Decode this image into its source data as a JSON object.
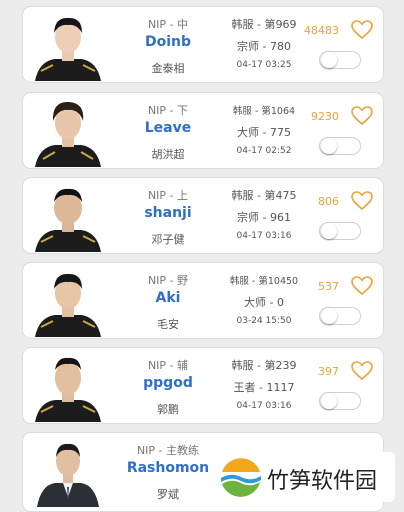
{
  "players": [
    {
      "team_role": "NIP - 中",
      "nickname": "Doinb",
      "real_name": "金泰相",
      "server_rank": "韩服 - 第969",
      "tier": "宗师 - 780",
      "time": "04-17 03:25",
      "likes": "48483",
      "toggle_on": false
    },
    {
      "team_role": "NIP - 下",
      "nickname": "Leave",
      "real_name": "胡洪超",
      "server_rank": "韩服 - 第1064",
      "tier": "大师 - 775",
      "time": "04-17 02:52",
      "likes": "9230",
      "toggle_on": false
    },
    {
      "team_role": "NIP - 上",
      "nickname": "shanji",
      "real_name": "邓子健",
      "server_rank": "韩服 - 第475",
      "tier": "宗师 - 961",
      "time": "04-17 03:16",
      "likes": "806",
      "toggle_on": false
    },
    {
      "team_role": "NIP - 野",
      "nickname": "Aki",
      "real_name": "毛安",
      "server_rank": "韩服 - 第10450",
      "tier": "大师 - 0",
      "time": "03-24 15:50",
      "likes": "537",
      "toggle_on": false
    },
    {
      "team_role": "NIP - 辅",
      "nickname": "ppgod",
      "real_name": "郭鹏",
      "server_rank": "韩服 - 第239",
      "tier": "王者 - 1117",
      "time": "04-17 03:16",
      "likes": "397",
      "toggle_on": false
    },
    {
      "team_role": "NIP - 主教练",
      "nickname": "Rashomon",
      "real_name": "罗斌",
      "server_rank": "",
      "tier": "",
      "time": "",
      "likes": "",
      "toggle_on": false
    }
  ],
  "watermark": {
    "text": "竹笋软件园"
  },
  "colors": {
    "nickname": "#2f6fc9",
    "likes": "#e8a43a",
    "card_bg": "#ffffff",
    "page_bg": "#ececec"
  }
}
